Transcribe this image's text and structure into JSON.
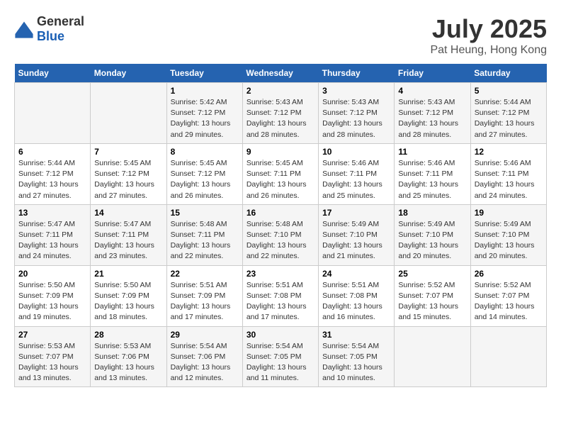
{
  "logo": {
    "general": "General",
    "blue": "Blue"
  },
  "title": "July 2025",
  "subtitle": "Pat Heung, Hong Kong",
  "days_of_week": [
    "Sunday",
    "Monday",
    "Tuesday",
    "Wednesday",
    "Thursday",
    "Friday",
    "Saturday"
  ],
  "weeks": [
    [
      {
        "day": "",
        "sunrise": "",
        "sunset": "",
        "daylight": ""
      },
      {
        "day": "",
        "sunrise": "",
        "sunset": "",
        "daylight": ""
      },
      {
        "day": "1",
        "sunrise": "Sunrise: 5:42 AM",
        "sunset": "Sunset: 7:12 PM",
        "daylight": "Daylight: 13 hours and 29 minutes."
      },
      {
        "day": "2",
        "sunrise": "Sunrise: 5:43 AM",
        "sunset": "Sunset: 7:12 PM",
        "daylight": "Daylight: 13 hours and 28 minutes."
      },
      {
        "day": "3",
        "sunrise": "Sunrise: 5:43 AM",
        "sunset": "Sunset: 7:12 PM",
        "daylight": "Daylight: 13 hours and 28 minutes."
      },
      {
        "day": "4",
        "sunrise": "Sunrise: 5:43 AM",
        "sunset": "Sunset: 7:12 PM",
        "daylight": "Daylight: 13 hours and 28 minutes."
      },
      {
        "day": "5",
        "sunrise": "Sunrise: 5:44 AM",
        "sunset": "Sunset: 7:12 PM",
        "daylight": "Daylight: 13 hours and 27 minutes."
      }
    ],
    [
      {
        "day": "6",
        "sunrise": "Sunrise: 5:44 AM",
        "sunset": "Sunset: 7:12 PM",
        "daylight": "Daylight: 13 hours and 27 minutes."
      },
      {
        "day": "7",
        "sunrise": "Sunrise: 5:45 AM",
        "sunset": "Sunset: 7:12 PM",
        "daylight": "Daylight: 13 hours and 27 minutes."
      },
      {
        "day": "8",
        "sunrise": "Sunrise: 5:45 AM",
        "sunset": "Sunset: 7:12 PM",
        "daylight": "Daylight: 13 hours and 26 minutes."
      },
      {
        "day": "9",
        "sunrise": "Sunrise: 5:45 AM",
        "sunset": "Sunset: 7:11 PM",
        "daylight": "Daylight: 13 hours and 26 minutes."
      },
      {
        "day": "10",
        "sunrise": "Sunrise: 5:46 AM",
        "sunset": "Sunset: 7:11 PM",
        "daylight": "Daylight: 13 hours and 25 minutes."
      },
      {
        "day": "11",
        "sunrise": "Sunrise: 5:46 AM",
        "sunset": "Sunset: 7:11 PM",
        "daylight": "Daylight: 13 hours and 25 minutes."
      },
      {
        "day": "12",
        "sunrise": "Sunrise: 5:46 AM",
        "sunset": "Sunset: 7:11 PM",
        "daylight": "Daylight: 13 hours and 24 minutes."
      }
    ],
    [
      {
        "day": "13",
        "sunrise": "Sunrise: 5:47 AM",
        "sunset": "Sunset: 7:11 PM",
        "daylight": "Daylight: 13 hours and 24 minutes."
      },
      {
        "day": "14",
        "sunrise": "Sunrise: 5:47 AM",
        "sunset": "Sunset: 7:11 PM",
        "daylight": "Daylight: 13 hours and 23 minutes."
      },
      {
        "day": "15",
        "sunrise": "Sunrise: 5:48 AM",
        "sunset": "Sunset: 7:11 PM",
        "daylight": "Daylight: 13 hours and 22 minutes."
      },
      {
        "day": "16",
        "sunrise": "Sunrise: 5:48 AM",
        "sunset": "Sunset: 7:10 PM",
        "daylight": "Daylight: 13 hours and 22 minutes."
      },
      {
        "day": "17",
        "sunrise": "Sunrise: 5:49 AM",
        "sunset": "Sunset: 7:10 PM",
        "daylight": "Daylight: 13 hours and 21 minutes."
      },
      {
        "day": "18",
        "sunrise": "Sunrise: 5:49 AM",
        "sunset": "Sunset: 7:10 PM",
        "daylight": "Daylight: 13 hours and 20 minutes."
      },
      {
        "day": "19",
        "sunrise": "Sunrise: 5:49 AM",
        "sunset": "Sunset: 7:10 PM",
        "daylight": "Daylight: 13 hours and 20 minutes."
      }
    ],
    [
      {
        "day": "20",
        "sunrise": "Sunrise: 5:50 AM",
        "sunset": "Sunset: 7:09 PM",
        "daylight": "Daylight: 13 hours and 19 minutes."
      },
      {
        "day": "21",
        "sunrise": "Sunrise: 5:50 AM",
        "sunset": "Sunset: 7:09 PM",
        "daylight": "Daylight: 13 hours and 18 minutes."
      },
      {
        "day": "22",
        "sunrise": "Sunrise: 5:51 AM",
        "sunset": "Sunset: 7:09 PM",
        "daylight": "Daylight: 13 hours and 17 minutes."
      },
      {
        "day": "23",
        "sunrise": "Sunrise: 5:51 AM",
        "sunset": "Sunset: 7:08 PM",
        "daylight": "Daylight: 13 hours and 17 minutes."
      },
      {
        "day": "24",
        "sunrise": "Sunrise: 5:51 AM",
        "sunset": "Sunset: 7:08 PM",
        "daylight": "Daylight: 13 hours and 16 minutes."
      },
      {
        "day": "25",
        "sunrise": "Sunrise: 5:52 AM",
        "sunset": "Sunset: 7:07 PM",
        "daylight": "Daylight: 13 hours and 15 minutes."
      },
      {
        "day": "26",
        "sunrise": "Sunrise: 5:52 AM",
        "sunset": "Sunset: 7:07 PM",
        "daylight": "Daylight: 13 hours and 14 minutes."
      }
    ],
    [
      {
        "day": "27",
        "sunrise": "Sunrise: 5:53 AM",
        "sunset": "Sunset: 7:07 PM",
        "daylight": "Daylight: 13 hours and 13 minutes."
      },
      {
        "day": "28",
        "sunrise": "Sunrise: 5:53 AM",
        "sunset": "Sunset: 7:06 PM",
        "daylight": "Daylight: 13 hours and 13 minutes."
      },
      {
        "day": "29",
        "sunrise": "Sunrise: 5:54 AM",
        "sunset": "Sunset: 7:06 PM",
        "daylight": "Daylight: 13 hours and 12 minutes."
      },
      {
        "day": "30",
        "sunrise": "Sunrise: 5:54 AM",
        "sunset": "Sunset: 7:05 PM",
        "daylight": "Daylight: 13 hours and 11 minutes."
      },
      {
        "day": "31",
        "sunrise": "Sunrise: 5:54 AM",
        "sunset": "Sunset: 7:05 PM",
        "daylight": "Daylight: 13 hours and 10 minutes."
      },
      {
        "day": "",
        "sunrise": "",
        "sunset": "",
        "daylight": ""
      },
      {
        "day": "",
        "sunrise": "",
        "sunset": "",
        "daylight": ""
      }
    ]
  ]
}
